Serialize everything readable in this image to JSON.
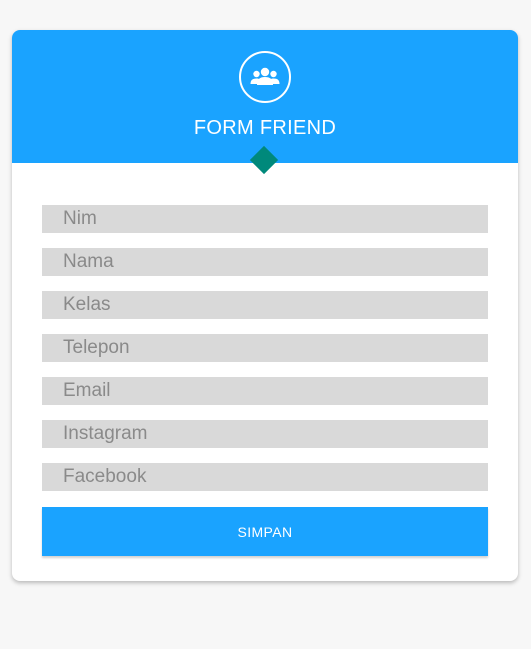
{
  "header": {
    "icon": "group-icon",
    "title": "FORM FRIEND"
  },
  "form": {
    "fields": [
      {
        "name": "nim",
        "placeholder": "Nim",
        "value": ""
      },
      {
        "name": "nama",
        "placeholder": "Nama",
        "value": ""
      },
      {
        "name": "kelas",
        "placeholder": "Kelas",
        "value": ""
      },
      {
        "name": "telepon",
        "placeholder": "Telepon",
        "value": ""
      },
      {
        "name": "email",
        "placeholder": "Email",
        "value": ""
      },
      {
        "name": "instagram",
        "placeholder": "Instagram",
        "value": ""
      },
      {
        "name": "facebook",
        "placeholder": "Facebook",
        "value": ""
      }
    ],
    "submit_label": "SIMPAN"
  },
  "colors": {
    "accent": "#1aa3ff",
    "diamond": "#00897b",
    "field_bg": "#d9d9d9"
  }
}
